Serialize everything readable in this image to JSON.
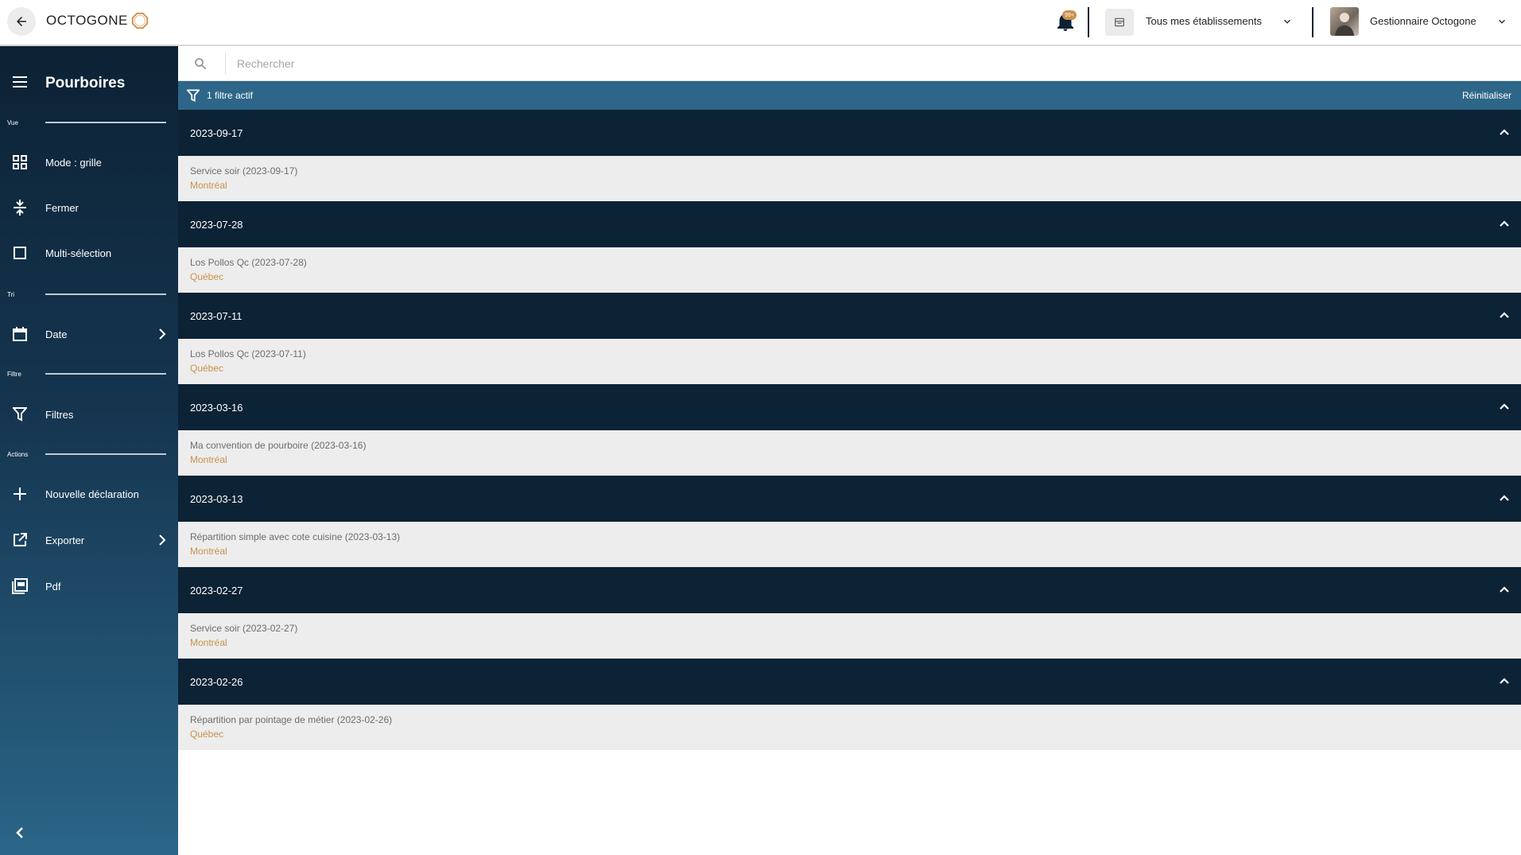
{
  "topbar": {
    "logo_text": "OCTOGONE",
    "notification_badge": "99+",
    "establishment_selector": "Tous mes établissements",
    "user_name": "Gestionnaire Octogone"
  },
  "sidebar": {
    "title": "Pourboires",
    "sections": {
      "vue": "Vue",
      "tri": "Tri",
      "filtre": "Filtre",
      "actions": "Actions"
    },
    "items": {
      "mode": "Mode : grille",
      "fermer": "Fermer",
      "multi": "Multi-sélection",
      "date": "Date",
      "filtres": "Filtres",
      "nouvelle": "Nouvelle déclaration",
      "exporter": "Exporter",
      "pdf": "Pdf"
    }
  },
  "search": {
    "placeholder": "Rechercher"
  },
  "filter_bar": {
    "active_label": "1 filtre actif",
    "reset_label": "Réinitialiser"
  },
  "groups": [
    {
      "date": "2023-09-17",
      "item": {
        "name": "Service soir (2023-09-17)",
        "city": "Montréal"
      }
    },
    {
      "date": "2023-07-28",
      "item": {
        "name": "Los Pollos Qc (2023-07-28)",
        "city": "Québec"
      }
    },
    {
      "date": "2023-07-11",
      "item": {
        "name": "Los Pollos Qc (2023-07-11)",
        "city": "Québec"
      }
    },
    {
      "date": "2023-03-16",
      "item": {
        "name": "Ma convention de pourboire (2023-03-16)",
        "city": "Montréal"
      }
    },
    {
      "date": "2023-03-13",
      "item": {
        "name": "Répartition simple avec cote cuisine (2023-03-13)",
        "city": "Montréal"
      }
    },
    {
      "date": "2023-02-27",
      "item": {
        "name": "Service soir (2023-02-27)",
        "city": "Montréal"
      }
    },
    {
      "date": "2023-02-26",
      "item": {
        "name": "Répartition par pointage de métier (2023-02-26)",
        "city": "Québec"
      }
    }
  ],
  "colors": {
    "navy": "#0c2235",
    "filter_bar": "#2d6688",
    "accent": "#c9914b",
    "row_bg": "#ededed"
  },
  "icons": {
    "back": "arrow-left-icon",
    "logo": "octagon-logo-icon",
    "bell": "bell-icon",
    "establishment": "store-icon",
    "menu": "hamburger-icon",
    "grid": "grid-icon",
    "close": "collapse-vertical-icon",
    "multi": "checkbox-icon",
    "date": "calendar-icon",
    "filter": "funnel-icon",
    "add": "plus-icon",
    "export": "export-icon",
    "pdf": "pdf-icon",
    "search": "search-icon",
    "chevron": "chevron-up-icon"
  }
}
